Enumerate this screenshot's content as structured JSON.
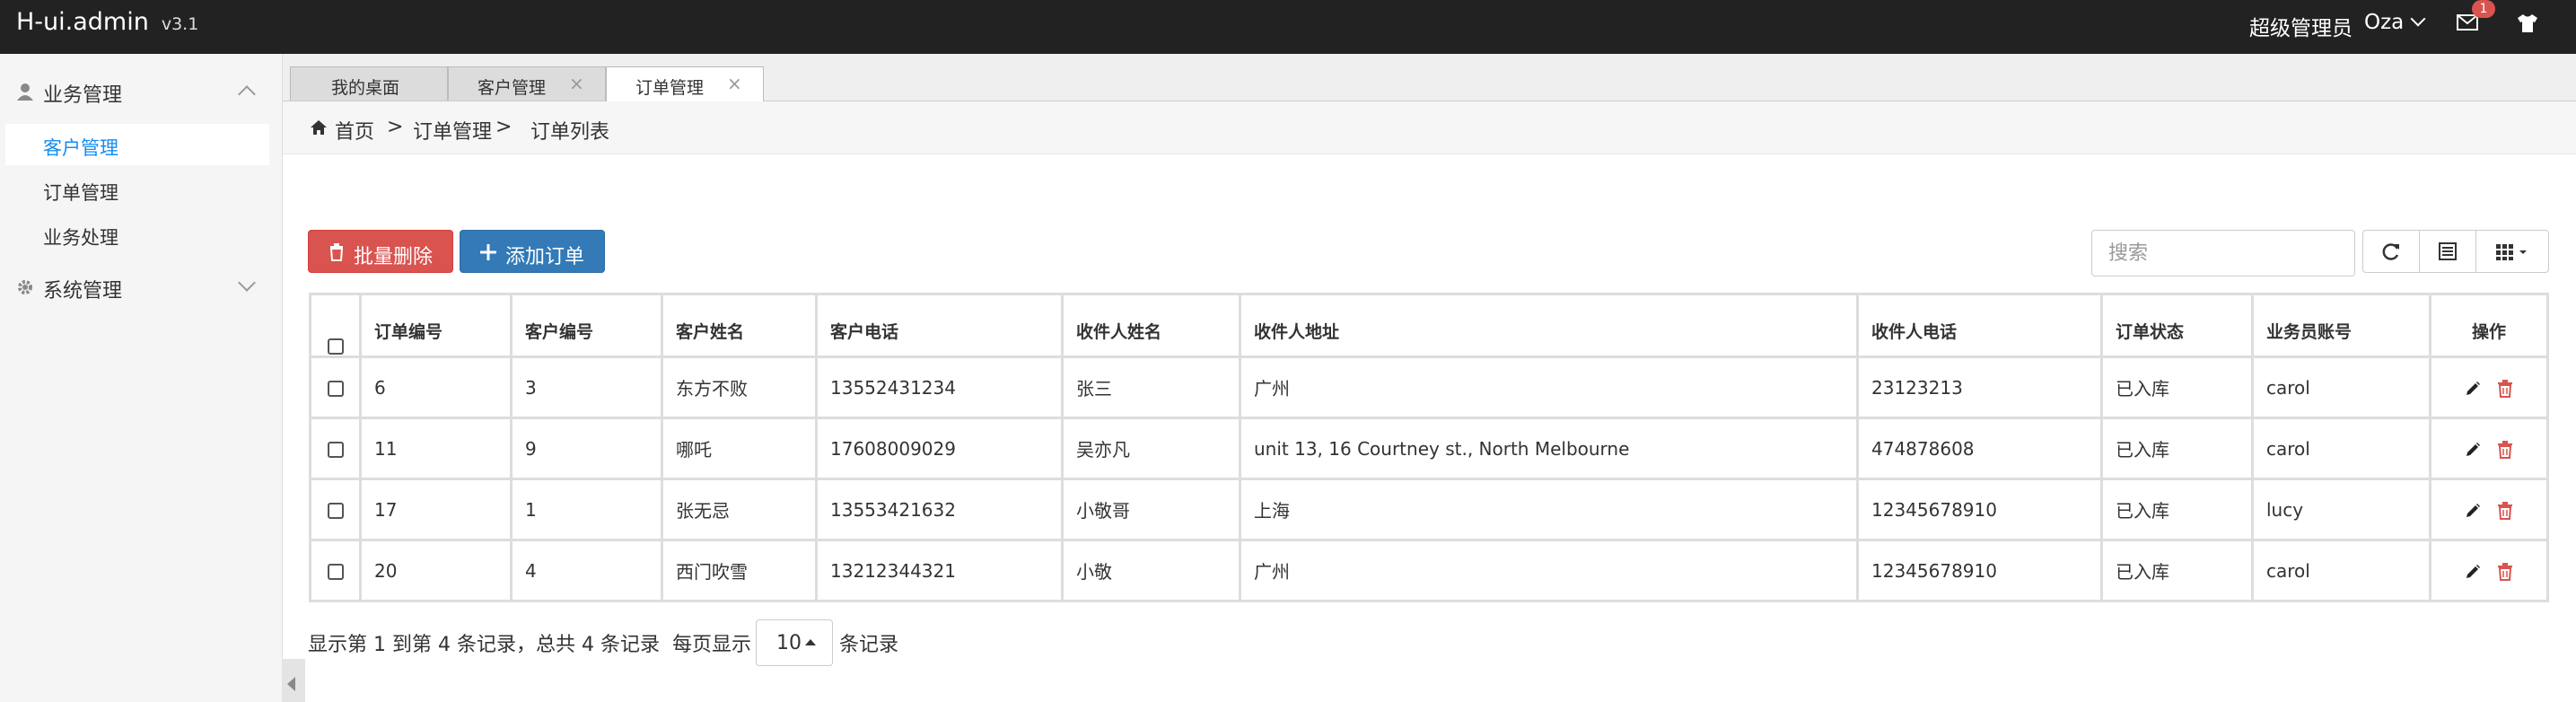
{
  "app": {
    "brand": "H-ui.admin",
    "version": "v3.1"
  },
  "topbar": {
    "role": "超级管理员",
    "user": "Oza",
    "message_badge": "1"
  },
  "sidebar": {
    "groups": [
      {
        "label": "业务管理",
        "icon": "user-icon",
        "expanded": true,
        "items": [
          {
            "label": "客户管理",
            "active": true
          },
          {
            "label": "订单管理"
          },
          {
            "label": "业务处理"
          }
        ]
      },
      {
        "label": "系统管理",
        "icon": "gear-icon",
        "expanded": false,
        "items": []
      }
    ]
  },
  "tabs": [
    {
      "label": "我的桌面"
    },
    {
      "label": "客户管理",
      "closable": true
    },
    {
      "label": "订单管理",
      "closable": true,
      "active": true
    }
  ],
  "breadcrumb": {
    "home": "首页",
    "sep": ">",
    "level2": "订单管理",
    "level3": "订单列表"
  },
  "toolbar": {
    "batch_delete": "批量删除",
    "add_order": "添加订单",
    "search_placeholder": "搜索"
  },
  "table": {
    "headers": [
      "订单编号",
      "客户编号",
      "客户姓名",
      "客户电话",
      "收件人姓名",
      "收件人地址",
      "收件人电话",
      "订单状态",
      "业务员账号",
      "操作"
    ],
    "rows": [
      [
        "6",
        "3",
        "东方不败",
        "13552431234",
        "张三",
        "广州",
        "23123213",
        "已入库",
        "carol"
      ],
      [
        "11",
        "9",
        "哪吒",
        "17608009029",
        "吴亦凡",
        "unit 13, 16 Courtney st., North Melbourne",
        "474878608",
        "已入库",
        "carol"
      ],
      [
        "17",
        "1",
        "张无忌",
        "13553421632",
        "小敬哥",
        "上海",
        "12345678910",
        "已入库",
        "lucy"
      ],
      [
        "20",
        "4",
        "西门吹雪",
        "13212344321",
        "小敬",
        "广州",
        "12345678910",
        "已入库",
        "carol"
      ]
    ]
  },
  "pagination": {
    "info": "显示第 1 到第 4 条记录，总共 4 条记录",
    "per_page_label": "每页显示",
    "page_size": "10",
    "suffix": "条记录"
  },
  "colors": {
    "danger": "#d9534f",
    "primary": "#337ab7",
    "link_active": "#148cf1",
    "topbar": "#222222"
  }
}
